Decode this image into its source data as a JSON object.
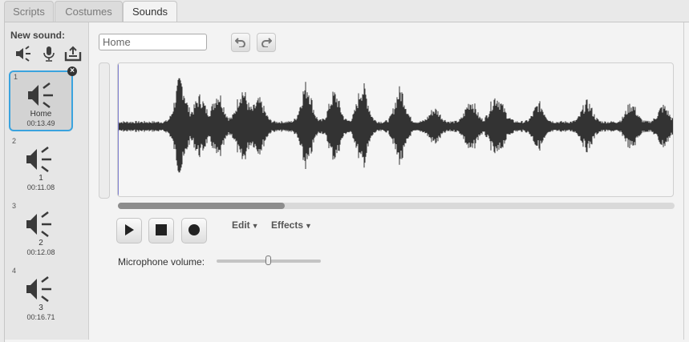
{
  "tabs": [
    {
      "label": "Scripts",
      "active": false
    },
    {
      "label": "Costumes",
      "active": false
    },
    {
      "label": "Sounds",
      "active": true
    }
  ],
  "sidebar": {
    "new_sound_label": "New sound:",
    "new_sound_icons": [
      "speaker-library-icon",
      "microphone-icon",
      "upload-icon"
    ],
    "sounds": [
      {
        "number": "1",
        "name": "Home",
        "duration": "00:13.49",
        "selected": true
      },
      {
        "number": "2",
        "name": "1",
        "duration": "00:11.08",
        "selected": false
      },
      {
        "number": "3",
        "name": "2",
        "duration": "00:12.08",
        "selected": false
      },
      {
        "number": "4",
        "name": "3",
        "duration": "00:16.71",
        "selected": false
      }
    ]
  },
  "editor": {
    "sound_name_value": "Home",
    "undo_icon": "undo-icon",
    "redo_icon": "redo-icon",
    "playback": {
      "play_icon": "play-icon",
      "stop_icon": "stop-icon",
      "record_icon": "record-icon"
    },
    "menus": {
      "edit_label": "Edit",
      "effects_label": "Effects"
    },
    "microphone_label": "Microphone volume:",
    "microphone_volume_fraction": 0.49,
    "scroll_visible_fraction": 0.3
  },
  "colors": {
    "selected_border": "#3aa3de",
    "waveform": "#333333",
    "cursor": "#7f7fd0"
  }
}
